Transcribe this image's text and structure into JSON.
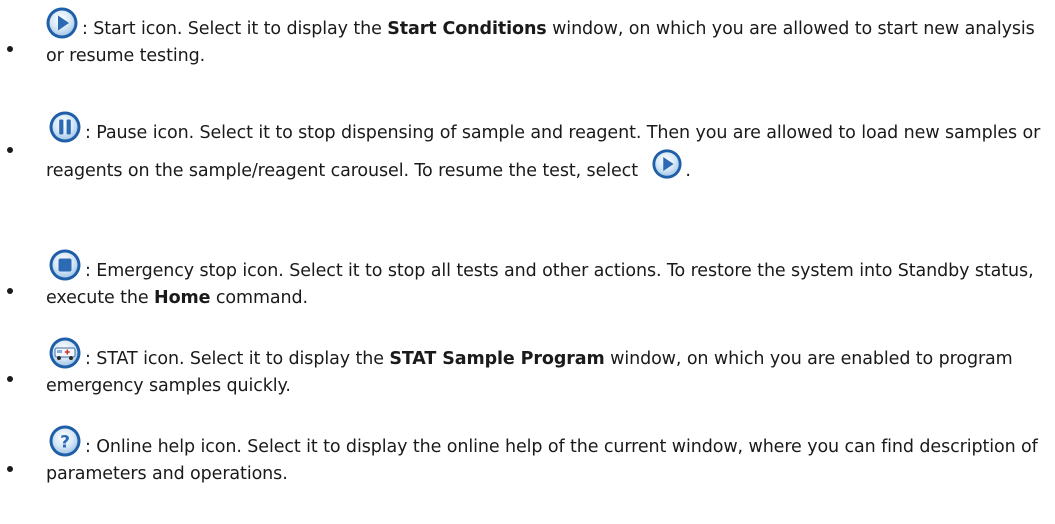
{
  "colors": {
    "icon_ring": "#1e5fa8",
    "icon_ring_light": "#6fa6da",
    "icon_fill": "#d7e8f7",
    "icon_glyph": "#2c6bb3",
    "text": "#1a1a1a"
  },
  "items": [
    {
      "icon": "play-icon",
      "lead": ": Start icon. Select it to display the ",
      "bold": "Start Conditions",
      "tail": " window, on which you are allowed to start new analysis or resume testing."
    },
    {
      "icon": "pause-icon",
      "lead": ": Pause icon. Select it to stop dispensing of sample and reagent. Then you are allowed to load new samples or reagents on the sample/reagent carousel. To resume the test, select ",
      "inline_icon": "play-icon",
      "tail": "."
    },
    {
      "icon": "stop-icon",
      "lead": ": Emergency stop icon. Select it to stop all tests and other actions. To restore the system into Standby status, execute the ",
      "bold": "Home",
      "tail": " command."
    },
    {
      "icon": "stat-ambulance-icon",
      "lead": ": STAT icon. Select it to display the ",
      "bold": "STAT Sample Program",
      "tail": " window, on which you are enabled to program emergency samples quickly."
    },
    {
      "icon": "help-icon",
      "lead": ": Online help icon. Select it to display the online help of the current window, where you can find description of parameters and operations."
    }
  ]
}
